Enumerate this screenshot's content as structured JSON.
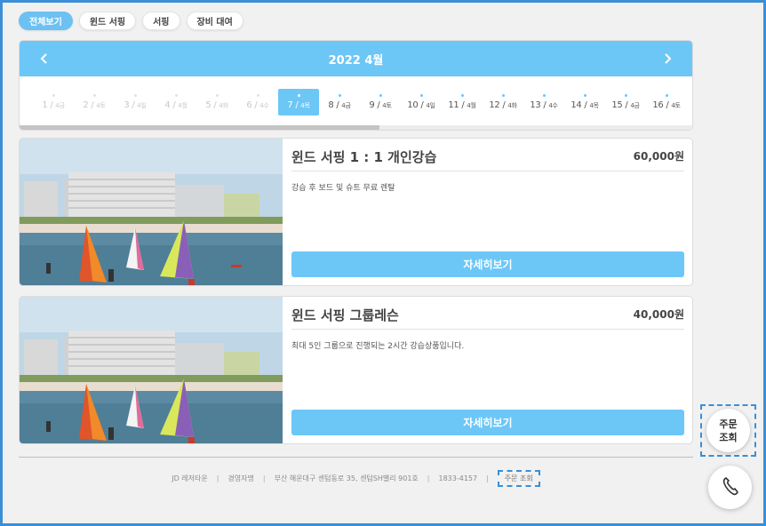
{
  "categories": [
    {
      "label": "전체보기",
      "active": true
    },
    {
      "label": "윈드 서핑",
      "active": false
    },
    {
      "label": "서핑",
      "active": false
    },
    {
      "label": "장비 대여",
      "active": false
    }
  ],
  "calendar": {
    "title": "2022 4월",
    "prev_icon": "chevron-left-icon",
    "next_icon": "chevron-right-icon",
    "days": [
      {
        "num": "1",
        "dow": "4금",
        "state": "past"
      },
      {
        "num": "2",
        "dow": "4토",
        "state": "past"
      },
      {
        "num": "3",
        "dow": "4일",
        "state": "past"
      },
      {
        "num": "4",
        "dow": "4월",
        "state": "past"
      },
      {
        "num": "5",
        "dow": "4화",
        "state": "past"
      },
      {
        "num": "6",
        "dow": "4수",
        "state": "past"
      },
      {
        "num": "7",
        "dow": "4목",
        "state": "selected"
      },
      {
        "num": "8",
        "dow": "4금",
        "state": "normal"
      },
      {
        "num": "9",
        "dow": "4토",
        "state": "normal"
      },
      {
        "num": "10",
        "dow": "4일",
        "state": "normal"
      },
      {
        "num": "11",
        "dow": "4월",
        "state": "normal"
      },
      {
        "num": "12",
        "dow": "4화",
        "state": "normal"
      },
      {
        "num": "13",
        "dow": "4수",
        "state": "normal"
      },
      {
        "num": "14",
        "dow": "4목",
        "state": "normal"
      },
      {
        "num": "15",
        "dow": "4금",
        "state": "normal"
      },
      {
        "num": "16",
        "dow": "4토",
        "state": "normal"
      }
    ]
  },
  "products": [
    {
      "title": "윈드 서핑 1 : 1 개인강습",
      "price": "60,000원",
      "description": "강습 후 보드 및 슈트 무료 렌탈",
      "button_label": "자세히보기"
    },
    {
      "title": "윈드 서핑 그룹레슨",
      "price": "40,000원",
      "description": "최대 5인 그룹으로 진행되는 2시간 강습상품입니다.",
      "button_label": "자세히보기"
    }
  ],
  "footer": {
    "company": "JD 레저타운",
    "owner": "경영자명",
    "address": "부산 해운대구 센텀동로 35, 센텀SH밸리 901호",
    "phone": "1833-4157",
    "order_link": "주문 조회"
  },
  "floating": {
    "order_line1": "주문",
    "order_line2": "조회",
    "phone_icon": "phone-icon"
  },
  "colors": {
    "accent": "#6cc7f7",
    "highlight_border": "#3a8fd6"
  }
}
